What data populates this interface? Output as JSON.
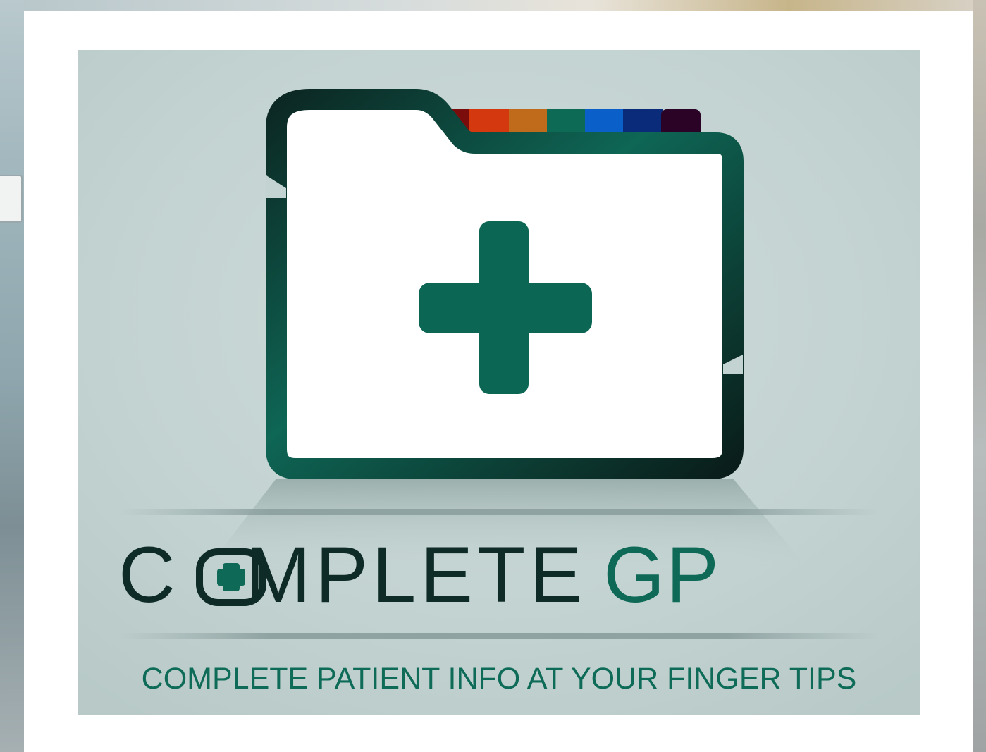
{
  "brand": {
    "name_part1": "COMPLETE",
    "name_part2": "GP",
    "tagline": "COMPLETE PATIENT INFO AT YOUR FINGER TIPS"
  },
  "icons": {
    "logo": "medical-folder-with-cross-icon",
    "wordmark_o": "cross-in-circle-icon"
  },
  "colors": {
    "dark_green": "#0f2b27",
    "brand_green": "#0e6957",
    "panel_bg": "#c3d3d1",
    "tab_colors": [
      "#7a0c0c",
      "#d4380f",
      "#c06a1b",
      "#0d6b55",
      "#0a5fc8",
      "#0a2a7a",
      "#2a0326"
    ]
  }
}
